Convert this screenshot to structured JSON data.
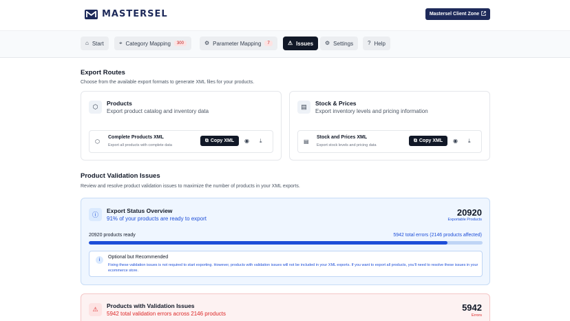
{
  "brand": {
    "name": "MASTERSEL"
  },
  "header": {
    "client_zone_label": "Mastersel Client Zone",
    "external_icon": "external-link-icon"
  },
  "tabs": [
    {
      "label": "Start",
      "icon": "home-icon"
    },
    {
      "label": "Category Mapping",
      "icon": "map-pin-icon",
      "badge": "300"
    },
    {
      "label": "Parameter Mapping",
      "icon": "cog-icon",
      "badge": "7"
    },
    {
      "label": "Issues",
      "icon": "warning-icon",
      "active": true
    },
    {
      "label": "Settings",
      "icon": "gear-icon"
    },
    {
      "label": "Help",
      "icon": "help-icon"
    }
  ],
  "export_routes": {
    "title": "Export Routes",
    "description": "Choose from the available export formats to generate XML files for your products.",
    "cards": [
      {
        "title": "Products",
        "subtitle": "Export product catalog and inventory data",
        "icon": "box-icon",
        "file": {
          "title": "Complete Products XML",
          "subtitle": "Export all products with complete data",
          "copy_label": "Copy XML"
        }
      },
      {
        "title": "Stock & Prices",
        "subtitle": "Export inventory levels and pricing information",
        "icon": "archive-icon",
        "file": {
          "title": "Stock and Prices XML",
          "subtitle": "Export stock levels and pricing data",
          "copy_label": "Copy XML"
        }
      }
    ]
  },
  "validation": {
    "title": "Product Validation Issues",
    "description": "Review and resolve product validation issues to maximize the number of products in your XML exports.",
    "status": {
      "title": "Export Status Overview",
      "subtitle": "91% of your products are ready to export",
      "count": "20920",
      "count_label": "Exportable Products",
      "ready_label": "20920 products ready",
      "errors_label": "5942 total errors (2146 products affected)",
      "progress": 0.91,
      "note_title": "Optional but Recommended",
      "note_body": "Fixing these validation issues is not required to start exporting. However, products with validation issues will not be included in your XML exports. If you want to export all products, you'll need to resolve these issues in your ecommerce store."
    },
    "errors": {
      "title": "Products with Validation Issues",
      "subtitle": "5942 total validation errors across 2146 products",
      "count": "5942",
      "count_label": "Errors"
    }
  },
  "colors": {
    "brand": "#1e2a5a",
    "accent": "#1d4ed8",
    "error": "#dc2626"
  }
}
